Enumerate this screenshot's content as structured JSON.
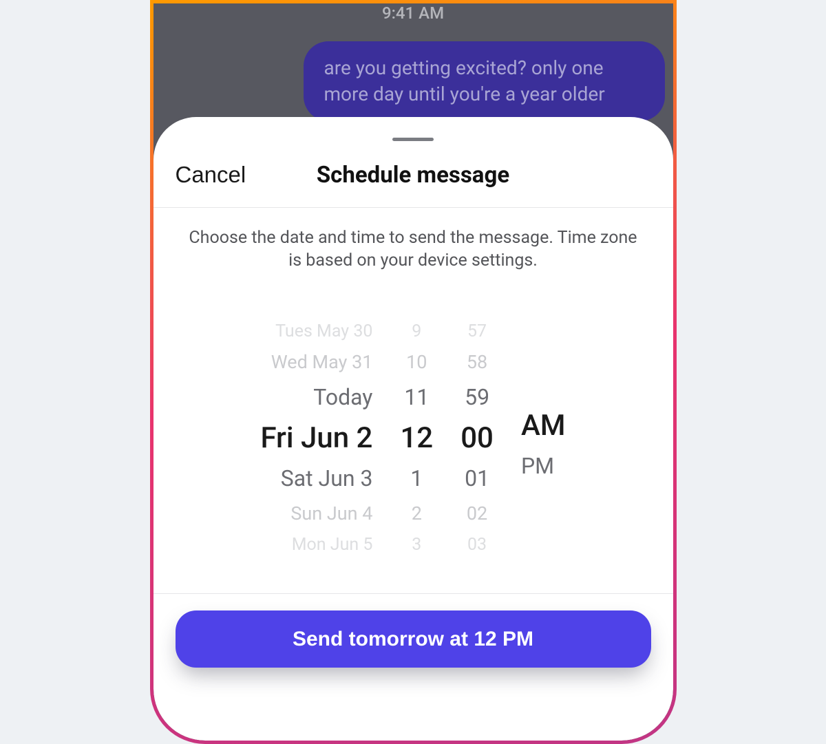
{
  "chat": {
    "timestamp": "9:41 AM",
    "message": "are you getting excited? only one more day until you're a year older"
  },
  "sheet": {
    "cancel_label": "Cancel",
    "title": "Schedule message",
    "instructions": "Choose the date and time to send the message. Time zone is based on your device settings.",
    "send_label": "Send tomorrow at 12 PM"
  },
  "picker": {
    "date": {
      "r0": "Tues May 30",
      "r1": "Wed May 31",
      "r2": "Today",
      "selected": "Fri Jun 2",
      "r4": "Sat Jun 3",
      "r5": "Sun Jun 4",
      "r6": "Mon Jun 5"
    },
    "hour": {
      "r0": "9",
      "r1": "10",
      "r2": "11",
      "selected": "12",
      "r4": "1",
      "r5": "2",
      "r6": "3"
    },
    "minute": {
      "r0": "57",
      "r1": "58",
      "r2": "59",
      "selected": "00",
      "r4": "01",
      "r5": "02",
      "r6": "03"
    },
    "ampm": {
      "selected": "AM",
      "r4": "PM"
    }
  }
}
